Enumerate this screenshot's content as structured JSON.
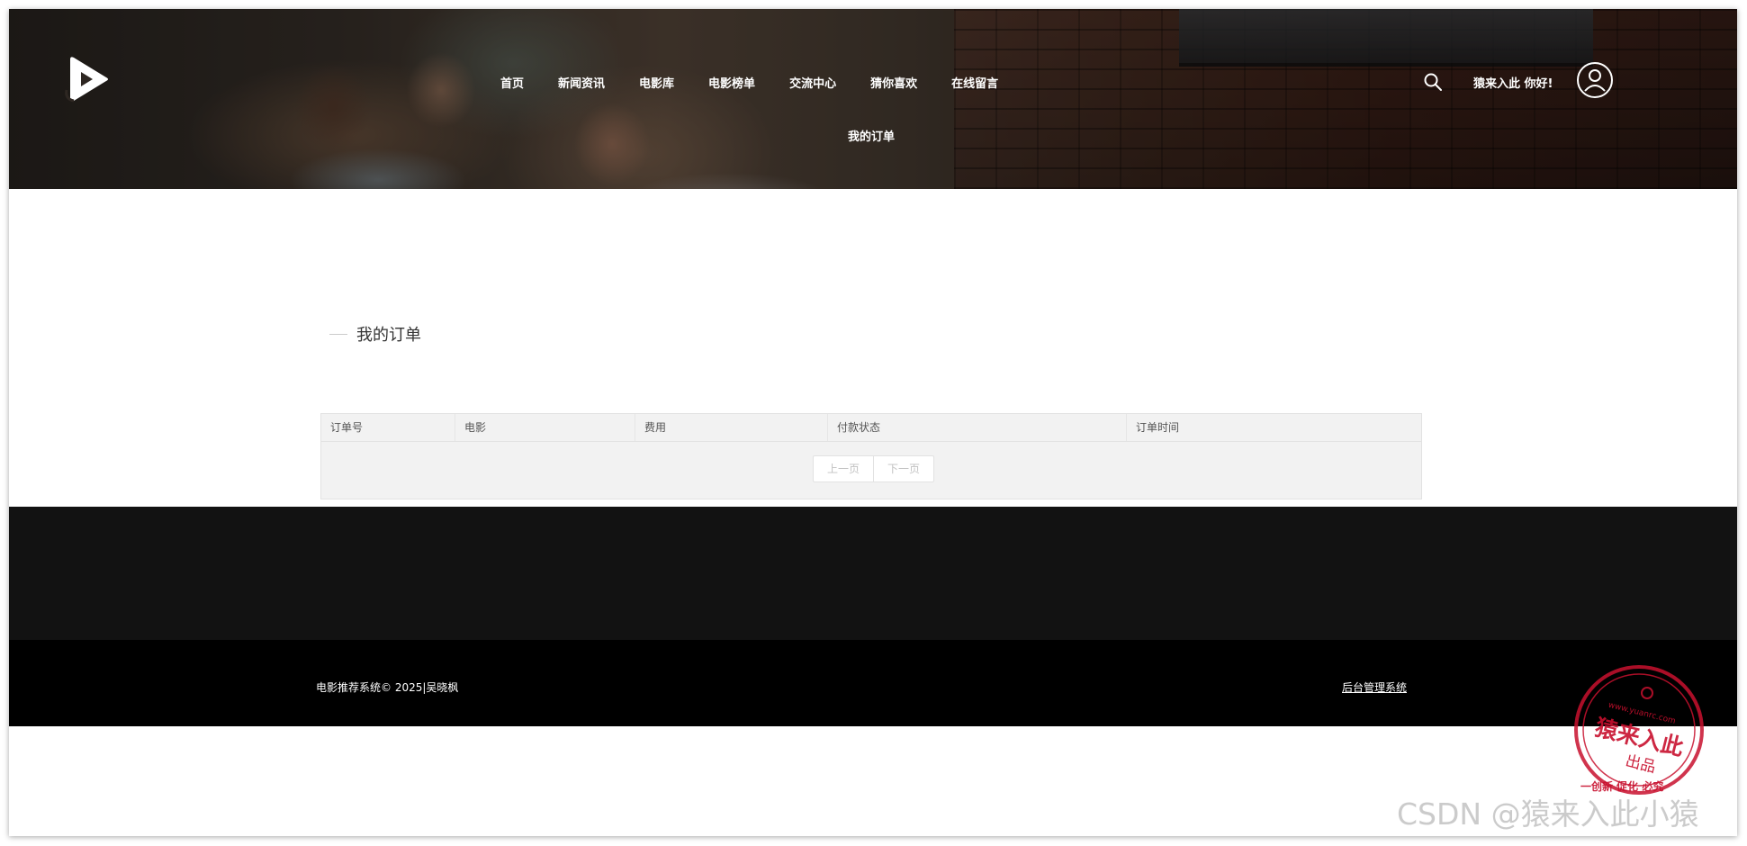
{
  "header": {
    "nav_items": [
      "首页",
      "新闻资讯",
      "电影库",
      "电影榜单",
      "交流中心",
      "猜你喜欢",
      "在线留言"
    ],
    "nav_sub_item": "我的订单",
    "greeting": "猿来入此 你好!"
  },
  "main": {
    "section_title": "我的订单",
    "table": {
      "columns": [
        "订单号",
        "电影",
        "费用",
        "付款状态",
        "订单时间"
      ]
    },
    "pagination": {
      "prev": "上一页",
      "next": "下一页"
    }
  },
  "footer": {
    "copyright": "电影推荐系统© 2025|吴晓枫",
    "admin_link": "后台管理系统"
  },
  "watermarks": {
    "stamp_url": "www.yuanrc.com",
    "stamp_main": "猿来入此",
    "stamp_sub": "出品",
    "stamp_motto": "一创新 促化 必究",
    "csdn": "CSDN @猿来入此小猿"
  },
  "colors": {
    "footer_top": "#121212",
    "footer_bottom": "#000000",
    "table_bg": "#f2f2f2",
    "stamp_red": "#c8102e"
  }
}
